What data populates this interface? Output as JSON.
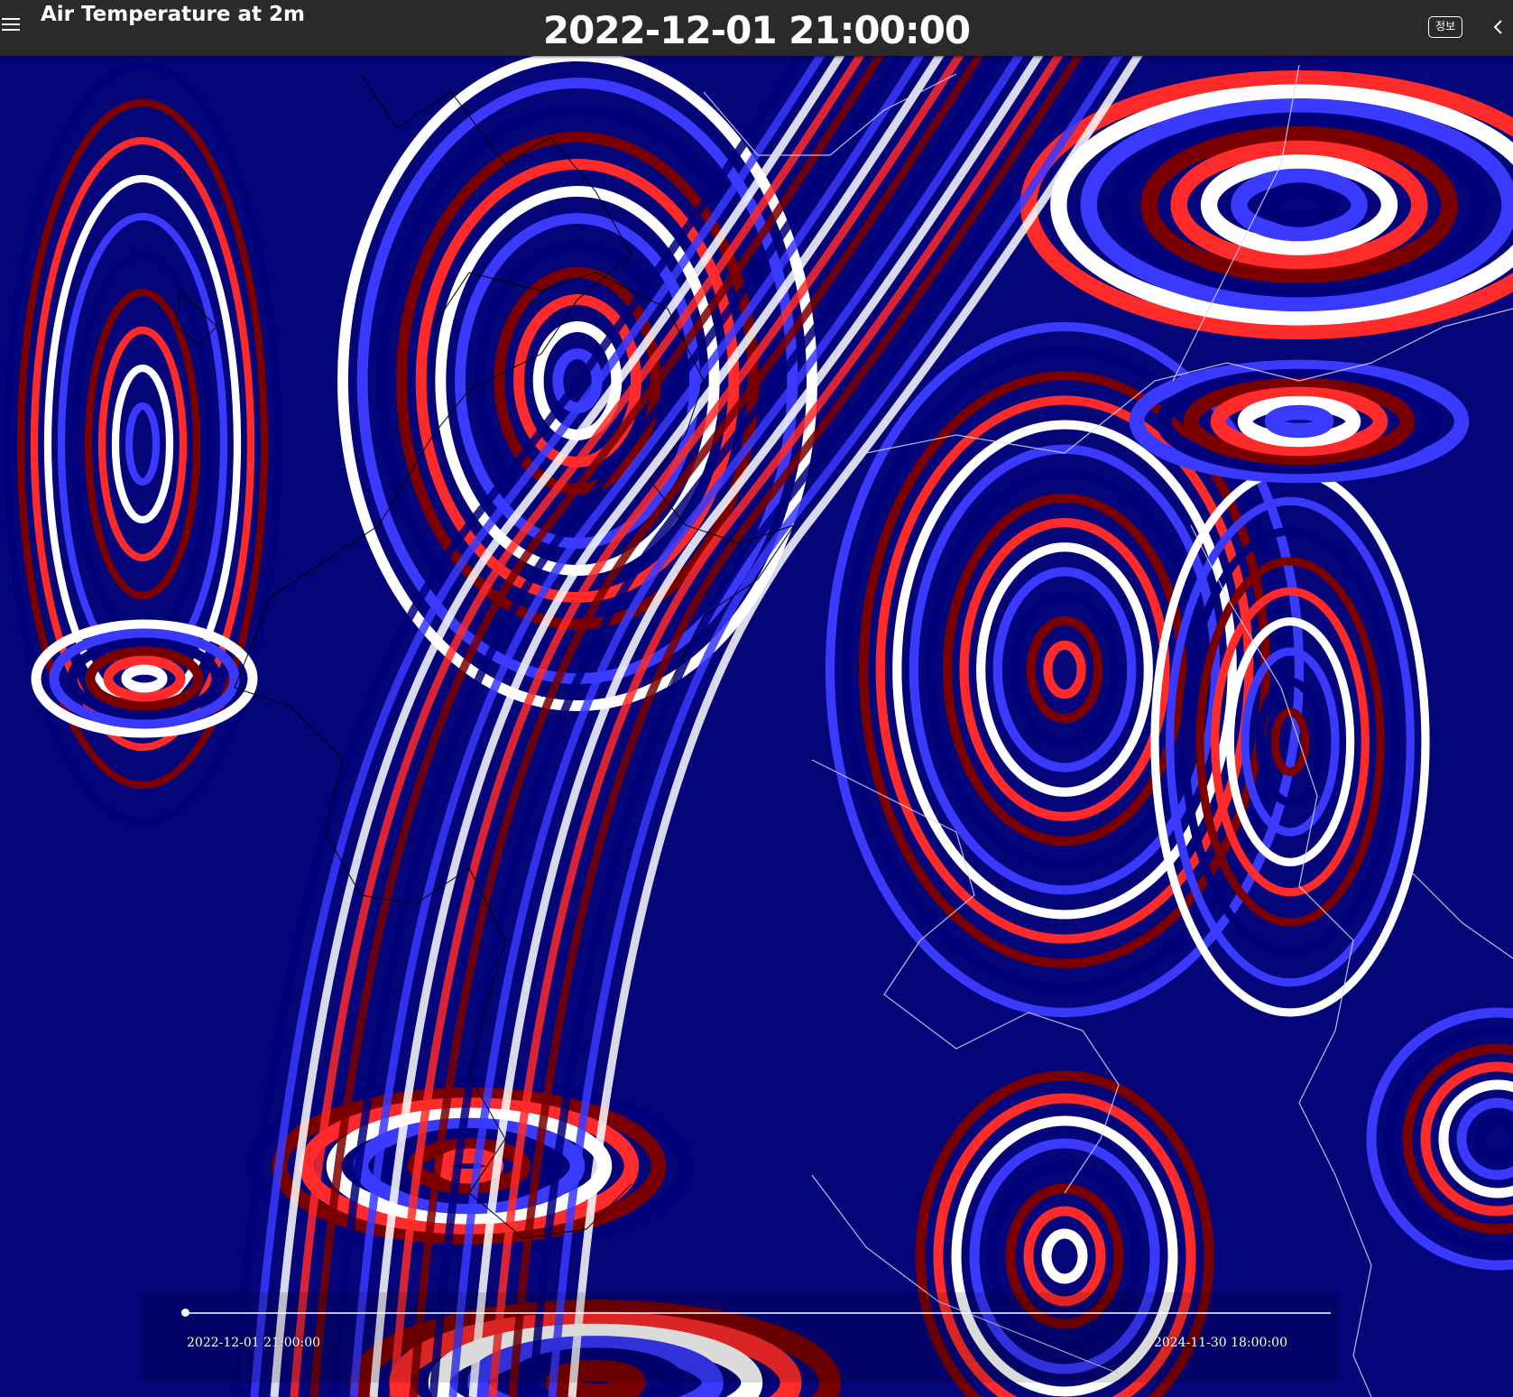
{
  "header": {
    "title": "Air Temperature at 2m",
    "current_time": "2022-12-01 21:00:00",
    "info_label": "정보",
    "menu_icon": "hamburger-menu-icon",
    "collapse_icon": "chevron-left-icon"
  },
  "map": {
    "layer": "Air Temperature at 2m",
    "colormap": [
      "#00007a",
      "#3a3aff",
      "#ffffff",
      "#ff2a2a",
      "#7a0000"
    ],
    "border_color_dark": "#000000",
    "border_color_light": "#d8d8ff"
  },
  "timeline": {
    "start_label": "2022-12-01 21:00:00",
    "end_label": "2024-11-30 18:00:00",
    "position": 0
  }
}
